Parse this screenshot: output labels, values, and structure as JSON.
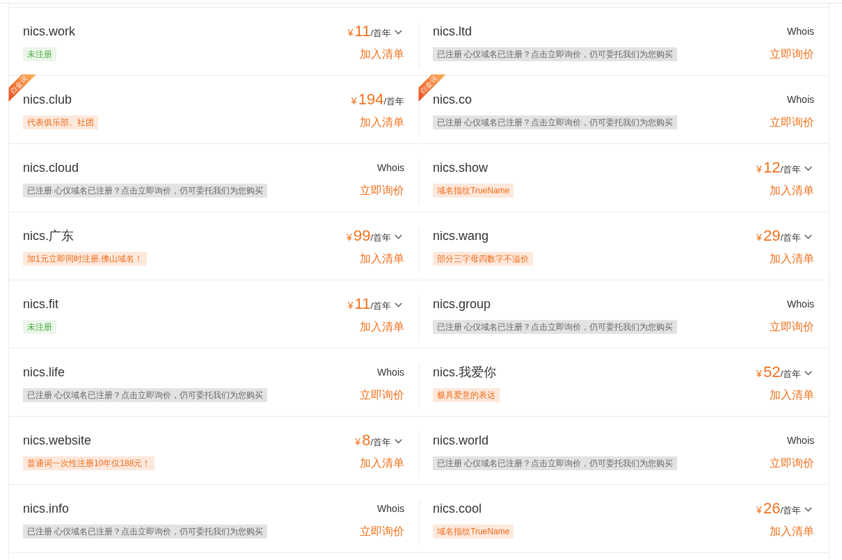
{
  "domains": [
    {
      "name": "nics.work",
      "kind": "available",
      "price": {
        "currency": "¥",
        "amount": "11",
        "unit": "/首年",
        "dropdown": true
      },
      "tag": {
        "kind": "unregistered",
        "text": "未注册"
      },
      "action": "加入清单"
    },
    {
      "name": "nics.ltd",
      "kind": "registered",
      "whois": "Whois",
      "tag": {
        "kind": "registered",
        "text": "已注册 心仪域名已注册？点击立即询价，仍可委托我们为您购买"
      },
      "action": "立即询价"
    },
    {
      "name": "nics.club",
      "kind": "available",
      "ribbon": "白金词",
      "price": {
        "currency": "¥",
        "amount": "194",
        "unit": "/首年",
        "dropdown": false
      },
      "tag": {
        "kind": "promo",
        "text": "代表俱乐部、社团"
      },
      "action": "加入清单"
    },
    {
      "name": "nics.co",
      "kind": "registered",
      "ribbon": "白金词",
      "whois": "Whois",
      "tag": {
        "kind": "registered",
        "text": "已注册 心仪域名已注册？点击立即询价，仍可委托我们为您购买"
      },
      "action": "立即询价"
    },
    {
      "name": "nics.cloud",
      "kind": "registered",
      "whois": "Whois",
      "tag": {
        "kind": "registered",
        "text": "已注册 心仪域名已注册？点击立即询价，仍可委托我们为您购买"
      },
      "action": "立即询价"
    },
    {
      "name": "nics.show",
      "kind": "available",
      "price": {
        "currency": "¥",
        "amount": "12",
        "unit": "/首年",
        "dropdown": true
      },
      "tag": {
        "kind": "promo",
        "text": "域名指纹TrueName"
      },
      "action": "加入清单"
    },
    {
      "name": "nics.广东",
      "kind": "available",
      "price": {
        "currency": "¥",
        "amount": "99",
        "unit": "/首年",
        "dropdown": true
      },
      "tag": {
        "kind": "promo",
        "text": "加1元立即同时注册.佛山域名！"
      },
      "action": "加入清单"
    },
    {
      "name": "nics.wang",
      "kind": "available",
      "price": {
        "currency": "¥",
        "amount": "29",
        "unit": "/首年",
        "dropdown": true
      },
      "tag": {
        "kind": "promo",
        "text": "部分三字母四数字不溢价"
      },
      "action": "加入清单"
    },
    {
      "name": "nics.fit",
      "kind": "available",
      "price": {
        "currency": "¥",
        "amount": "11",
        "unit": "/首年",
        "dropdown": true
      },
      "tag": {
        "kind": "unregistered",
        "text": "未注册"
      },
      "action": "加入清单"
    },
    {
      "name": "nics.group",
      "kind": "registered",
      "whois": "Whois",
      "tag": {
        "kind": "registered",
        "text": "已注册 心仪域名已注册？点击立即询价，仍可委托我们为您购买"
      },
      "action": "立即询价"
    },
    {
      "name": "nics.life",
      "kind": "registered",
      "whois": "Whois",
      "tag": {
        "kind": "registered",
        "text": "已注册 心仪域名已注册？点击立即询价，仍可委托我们为您购买"
      },
      "action": "立即询价"
    },
    {
      "name": "nics.我爱你",
      "kind": "available",
      "price": {
        "currency": "¥",
        "amount": "52",
        "unit": "/首年",
        "dropdown": true
      },
      "tag": {
        "kind": "promo",
        "text": "极具爱意的表达"
      },
      "action": "加入清单"
    },
    {
      "name": "nics.website",
      "kind": "available",
      "price": {
        "currency": "¥",
        "amount": "8",
        "unit": "/首年",
        "dropdown": true
      },
      "tag": {
        "kind": "promo",
        "text": "普通词一次性注册10年仅188元！"
      },
      "action": "加入清单"
    },
    {
      "name": "nics.world",
      "kind": "registered",
      "whois": "Whois",
      "tag": {
        "kind": "registered",
        "text": "已注册 心仪域名已注册？点击立即询价，仍可委托我们为您购买"
      },
      "action": "立即询价"
    },
    {
      "name": "nics.info",
      "kind": "registered",
      "whois": "Whois",
      "tag": {
        "kind": "registered",
        "text": "已注册 心仪域名已注册？点击立即询价，仍可委托我们为您购买"
      },
      "action": "立即询价"
    },
    {
      "name": "nics.cool",
      "kind": "available",
      "price": {
        "currency": "¥",
        "amount": "26",
        "unit": "/首年",
        "dropdown": true
      },
      "tag": {
        "kind": "promo",
        "text": "域名指纹TrueName"
      },
      "action": "加入清单"
    }
  ]
}
